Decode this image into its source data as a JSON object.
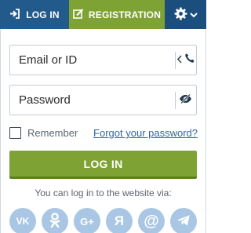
{
  "tabs": {
    "login_label": "LOG IN",
    "registration_label": "REGISTRATION"
  },
  "form": {
    "login_placeholder": "Email or ID",
    "password_placeholder": "Password",
    "remember_label": "Remember",
    "forgot_link": "Forgot your password?",
    "submit_label": "LOG IN"
  },
  "social": {
    "intro": "You can log in to the website via:",
    "providers": [
      "vk-icon",
      "odnoklassniki-icon",
      "google-plus-icon",
      "yandex-icon",
      "mail-at-icon",
      "telegram-icon"
    ],
    "vk_text": "VK",
    "google_text": "G+",
    "yandex_text": "Я"
  },
  "colors": {
    "tab_login": "#235a8c",
    "tab_registration": "#7fa234",
    "tab_settings": "#1b4e7d",
    "button_green": "#7fa234",
    "link_blue": "#2f68a8",
    "social_bubble": "#a9c6e4"
  },
  "icons": {
    "login_tab": "sign-in-icon",
    "registration_tab": "edit-icon",
    "settings_tab": "gear-icon",
    "settings_dropdown": "chevron-down-icon",
    "phone_toggle": "phone-icon",
    "show_password": "eye-slash-icon"
  }
}
